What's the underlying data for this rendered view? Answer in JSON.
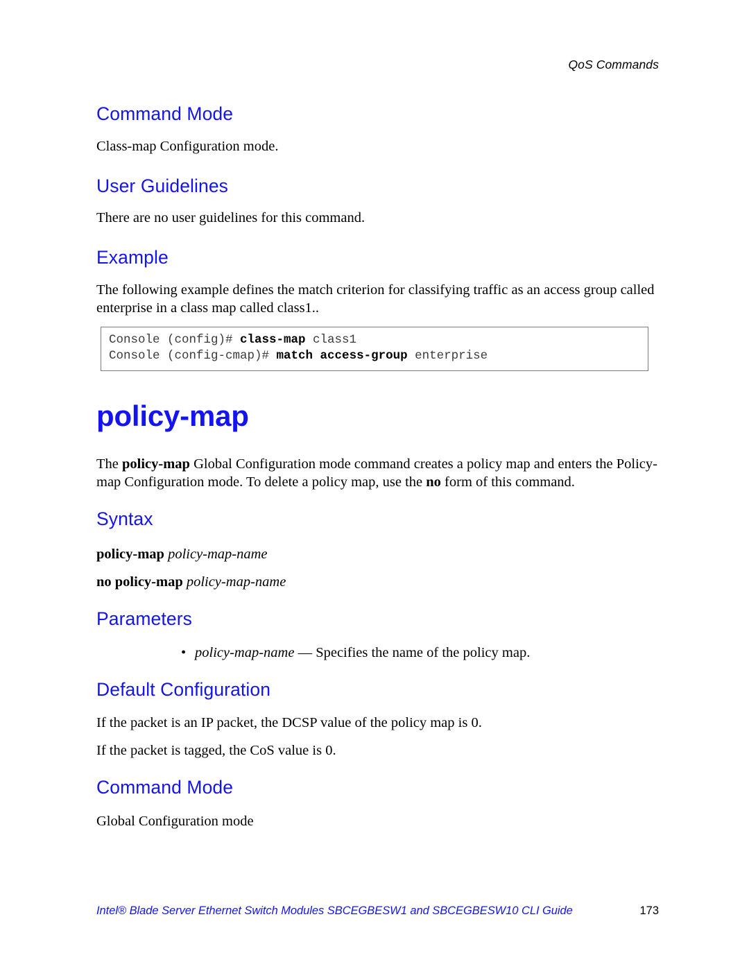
{
  "header": {
    "running_head": "QoS Commands"
  },
  "sections": {
    "command_mode_1": {
      "heading": "Command Mode",
      "body": "Class-map Configuration mode."
    },
    "user_guidelines": {
      "heading": "User Guidelines",
      "body": "There are no user guidelines for this command."
    },
    "example": {
      "heading": "Example",
      "body": "The following example defines the match criterion for classifying traffic as an access group called enterprise in a class map called class1..",
      "code_lines": [
        {
          "prompt": "Console (config)# ",
          "command": "class-map",
          "argument": " class1"
        },
        {
          "prompt": "Console (config-cmap)# ",
          "command": "match access-group",
          "argument": " enterprise"
        }
      ]
    },
    "policy_map": {
      "title": "policy-map",
      "description_part1": "The ",
      "description_bold1": "policy-map",
      "description_part2": " Global Configuration mode command creates a policy map and enters the Policy-map Configuration mode. To delete a policy map, use the ",
      "description_bold2": "no",
      "description_part3": " form of this command."
    },
    "syntax": {
      "heading": "Syntax",
      "lines": [
        {
          "command": "policy-map",
          "placeholder": " policy-map-name"
        },
        {
          "command": "no policy-map",
          "placeholder": " policy-map-name"
        }
      ]
    },
    "parameters": {
      "heading": "Parameters",
      "items": [
        {
          "bullet": "•",
          "name": "policy-map-name",
          "description": " — Specifies the name of the policy map."
        }
      ]
    },
    "default_configuration": {
      "heading": "Default Configuration",
      "body_line1": "If the packet is an IP packet, the DCSP value of the policy map is 0.",
      "body_line2": "If the packet is tagged, the CoS value is 0."
    },
    "command_mode_2": {
      "heading": "Command Mode",
      "body": "Global Configuration mode"
    }
  },
  "footer": {
    "title": "Intel® Blade Server Ethernet Switch Modules SBCEGBESW1 and SBCEGBESW10 CLI Guide",
    "page_number": "173"
  },
  "colors": {
    "heading_blue": "#1414f0",
    "text_black": "#000000",
    "code_gray": "#3b3b3b",
    "border_gray": "#7b7b7b"
  }
}
